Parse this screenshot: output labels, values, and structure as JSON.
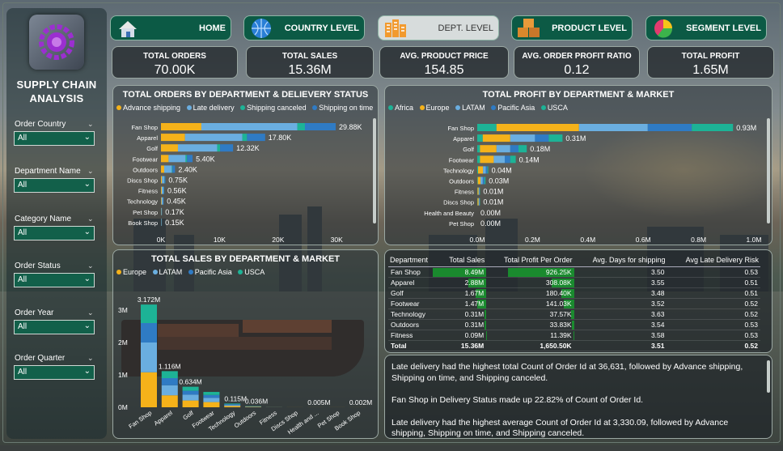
{
  "sidebar": {
    "title": "SUPPLY CHAIN ANALYSIS",
    "filters": [
      {
        "label": "Order Country",
        "value": "All"
      },
      {
        "label": "Department Name",
        "value": "All"
      },
      {
        "label": "Category Name",
        "value": "All"
      },
      {
        "label": "Order Status",
        "value": "All"
      },
      {
        "label": "Order Year",
        "value": "All"
      },
      {
        "label": "Order Quarter",
        "value": "All"
      }
    ]
  },
  "nav": [
    {
      "label": "HOME",
      "icon": "house-icon"
    },
    {
      "label": "COUNTRY LEVEL",
      "icon": "globe-icon"
    },
    {
      "label": "DEPT. LEVEL",
      "icon": "buildings-icon",
      "selected": true
    },
    {
      "label": "PRODUCT LEVEL",
      "icon": "boxes-icon"
    },
    {
      "label": "SEGMENT LEVEL",
      "icon": "pie-icon"
    }
  ],
  "kpis": [
    {
      "title": "TOTAL ORDERS",
      "value": "70.00K"
    },
    {
      "title": "TOTAL SALES",
      "value": "15.36M"
    },
    {
      "title": "AVG. PRODUCT PRICE",
      "value": "154.85"
    },
    {
      "title": "AVG. ORDER PROFIT RATIO",
      "value": "0.12"
    },
    {
      "title": "TOTAL PROFIT",
      "value": "1.65M"
    }
  ],
  "colors": {
    "advance": "#f5b21a",
    "late": "#6aaee0",
    "canceled": "#1db396",
    "ontime": "#2f7bc4",
    "africa": "#1db396",
    "europe": "#f5b21a",
    "latam": "#6aaee0",
    "pacific": "#2f7bc4",
    "usca": "#1db396"
  },
  "chart_data": [
    {
      "type": "bar",
      "orientation": "horizontal",
      "stacked": true,
      "title": "TOTAL ORDERS BY DEPARTMENT & DELIEVERY STATUS",
      "categories": [
        "Fan Shop",
        "Apparel",
        "Golf",
        "Footwear",
        "Outdoors",
        "Discs Shop",
        "Fitness",
        "Technology",
        "Pet Shop",
        "Book Shop"
      ],
      "series": [
        {
          "name": "Advance shipping",
          "values": [
            6.9,
            4.1,
            2.9,
            1.3,
            0.55,
            0.17,
            0.13,
            0.1,
            0.04,
            0.03
          ]
        },
        {
          "name": "Late delivery",
          "values": [
            16.4,
            9.8,
            6.7,
            2.9,
            1.3,
            0.42,
            0.31,
            0.25,
            0.09,
            0.08
          ]
        },
        {
          "name": "Shipping canceled",
          "values": [
            1.3,
            0.8,
            0.5,
            0.25,
            0.1,
            0.03,
            0.03,
            0.02,
            0.01,
            0.01
          ]
        },
        {
          "name": "Shipping on time",
          "values": [
            5.25,
            3.1,
            2.22,
            0.95,
            0.45,
            0.13,
            0.09,
            0.08,
            0.03,
            0.03
          ]
        }
      ],
      "data_labels": [
        "29.88K",
        "17.80K",
        "12.32K",
        "5.40K",
        "2.40K",
        "0.75K",
        "0.56K",
        "0.45K",
        "0.17K",
        "0.15K"
      ],
      "xticks": [
        "0K",
        "10K",
        "20K",
        "30K"
      ],
      "xlim": [
        0,
        34
      ]
    },
    {
      "type": "bar",
      "orientation": "horizontal",
      "stacked": true,
      "title": "TOTAL PROFIT BY DEPARTMENT & MARKET",
      "categories": [
        "Fan Shop",
        "Apparel",
        "Golf",
        "Footwear",
        "Technology",
        "Outdoors",
        "Fitness",
        "Discs Shop",
        "Health and Beauty",
        "Pet Shop"
      ],
      "series": [
        {
          "name": "Africa",
          "values": [
            0.07,
            0.02,
            0.01,
            0.01,
            0.003,
            0.002,
            0.001,
            0.001,
            0,
            0
          ]
        },
        {
          "name": "Europe",
          "values": [
            0.3,
            0.1,
            0.06,
            0.05,
            0.018,
            0.01,
            0.004,
            0.004,
            0,
            0
          ]
        },
        {
          "name": "LATAM",
          "values": [
            0.25,
            0.09,
            0.05,
            0.04,
            0.01,
            0.008,
            0.003,
            0.003,
            0,
            0
          ]
        },
        {
          "name": "Pacific Asia",
          "values": [
            0.16,
            0.05,
            0.03,
            0.02,
            0.006,
            0.006,
            0.001,
            0.001,
            0,
            0
          ]
        },
        {
          "name": "USCA",
          "values": [
            0.15,
            0.05,
            0.03,
            0.02,
            0.003,
            0.004,
            0.001,
            0.001,
            0,
            0
          ]
        }
      ],
      "data_labels": [
        "0.93M",
        "0.31M",
        "0.18M",
        "0.14M",
        "0.04M",
        "0.03M",
        "0.01M",
        "0.01M",
        "0.00M",
        "0.00M"
      ],
      "xticks": [
        "0.0M",
        "0.2M",
        "0.4M",
        "0.6M",
        "0.8M",
        "1.0M"
      ],
      "xlim": [
        0,
        1.0
      ]
    },
    {
      "type": "bar",
      "orientation": "vertical",
      "stacked": true,
      "title": "TOTAL SALES BY DEPARTMENT & MARKET",
      "categories": [
        "Fan Shop",
        "Apparel",
        "Golf",
        "Footwear",
        "Technology",
        "Outdoors",
        "Fitness",
        "Discs Shop",
        "Health and ...",
        "Pet Shop",
        "Book Shop"
      ],
      "series": [
        {
          "name": "Europe",
          "values": [
            1.08,
            0.37,
            0.21,
            0.16,
            0.04,
            0.012,
            0.002,
            0.001,
            0.001,
            0.001,
            0.001
          ]
        },
        {
          "name": "LATAM",
          "values": [
            0.92,
            0.31,
            0.18,
            0.13,
            0.03,
            0.01,
            0.001,
            0,
            0,
            0,
            0
          ]
        },
        {
          "name": "Pacific Asia",
          "values": [
            0.6,
            0.22,
            0.12,
            0.09,
            0.025,
            0.008,
            0.001,
            0,
            0,
            0,
            0
          ]
        },
        {
          "name": "USCA",
          "values": [
            0.572,
            0.216,
            0.124,
            0.094,
            0.02,
            0.006,
            0.001,
            0,
            0,
            0,
            0
          ]
        }
      ],
      "data_labels": [
        "3.172M",
        "1.116M",
        "0.634M",
        "",
        "0.115M",
        "0.036M",
        "",
        "",
        "0.005M",
        "",
        "0.002M"
      ],
      "yticks": [
        "0M",
        "1M",
        "2M",
        "3M"
      ],
      "ylim": [
        0,
        3.5
      ]
    },
    {
      "type": "table",
      "columns": [
        "Department",
        "Total Sales",
        "Total Profit Per Order",
        "Avg. Days for shipping",
        "Avg Late Delivery Risk"
      ],
      "rows": [
        [
          "Fan Shop",
          "8.49M",
          "926.25K",
          "3.50",
          "0.53"
        ],
        [
          "Apparel",
          "2.88M",
          "308.08K",
          "3.55",
          "0.51"
        ],
        [
          "Golf",
          "1.67M",
          "180.40K",
          "3.48",
          "0.51"
        ],
        [
          "Footwear",
          "1.47M",
          "141.03K",
          "3.52",
          "0.52"
        ],
        [
          "Technology",
          "0.31M",
          "37.57K",
          "3.63",
          "0.52"
        ],
        [
          "Outdoors",
          "0.31M",
          "33.83K",
          "3.54",
          "0.53"
        ],
        [
          "Fitness",
          "0.09M",
          "11.39K",
          "3.58",
          "0.53"
        ]
      ],
      "sales_values": [
        8.49,
        2.88,
        1.67,
        1.47,
        0.31,
        0.31,
        0.09
      ],
      "profit_values": [
        926.25,
        308.08,
        180.4,
        141.03,
        37.57,
        33.83,
        11.39
      ],
      "total": [
        "Total",
        "15.36M",
        "1,650.50K",
        "3.51",
        "0.52"
      ]
    }
  ],
  "insights": [
    "Late delivery had the highest total Count of Order Id at 36,631, followed by Advance shipping, Shipping on time, and Shipping canceled.",
    "Fan Shop in Delivery Status  made up 22.82% of Count of Order Id.",
    "Late delivery had the highest average Count of Order Id at 3,330.09, followed by Advance shipping, Shipping on time, and Shipping canceled."
  ]
}
